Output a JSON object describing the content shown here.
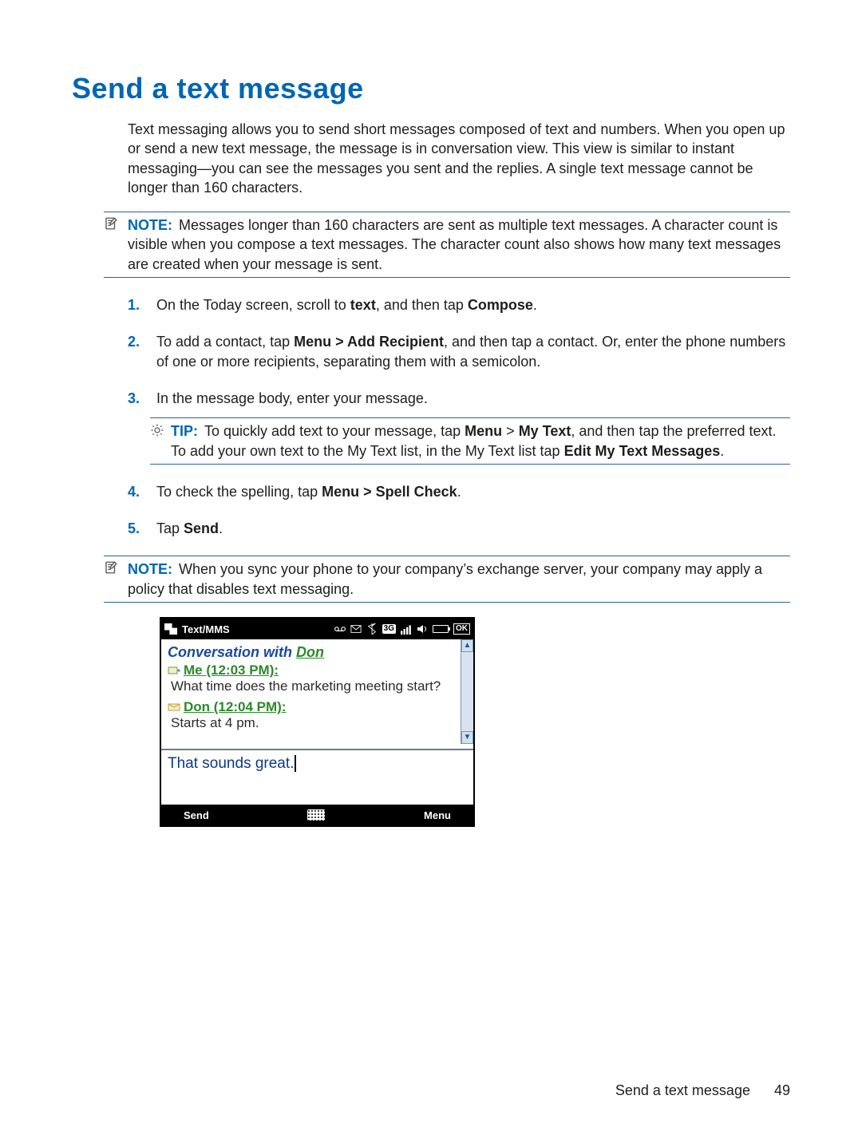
{
  "title": "Send a text message",
  "intro": "Text messaging allows you to send short messages composed of text and numbers. When you open up or send a new text message, the message is in conversation view. This view is similar to instant messaging—you can see the messages you sent and the replies. A single text message cannot be longer than 160 characters.",
  "note1": {
    "label": "NOTE:",
    "text": "Messages longer than 160 characters are sent as multiple text messages. A character count is visible when you compose a text messages. The character count also shows how many text messages are created when your message is sent."
  },
  "steps": {
    "s1_a": "On the Today screen, scroll to ",
    "s1_b": "text",
    "s1_c": ", and then tap ",
    "s1_d": "Compose",
    "s1_e": ".",
    "s2_a": "To add a contact, tap ",
    "s2_b": "Menu > Add Recipient",
    "s2_c": ", and then tap a contact. Or, enter the phone numbers of one or more recipients, separating them with a semicolon.",
    "s3": "In the message body, enter your message.",
    "s4_a": "To check the spelling, tap ",
    "s4_b": "Menu > Spell Check",
    "s4_c": ".",
    "s5_a": "Tap ",
    "s5_b": "Send",
    "s5_c": "."
  },
  "tip": {
    "label": "TIP:",
    "a": "To quickly add text to your message, tap ",
    "b": "Menu",
    "c": " > ",
    "d": "My Text",
    "e": ", and then tap the preferred text. To add your own text to the My Text list, in the My Text list tap ",
    "f": "Edit My Text Messages",
    "g": "."
  },
  "note2": {
    "label": "NOTE:",
    "text": "When you sync your phone to your company’s exchange server, your company may apply a policy that disables text messaging."
  },
  "phone": {
    "title": "Text/MMS",
    "ok": "OK",
    "ind3g": "3G",
    "conversation_prefix": "Conversation with ",
    "contact": "Don",
    "me_label": "Me (12:03 PM):",
    "me_msg": "What time does the marketing meeting start?",
    "don_label": "Don (12:04 PM):",
    "don_msg": "Starts at 4 pm.",
    "compose": "That sounds great.",
    "soft_left": "Send",
    "soft_right": "Menu"
  },
  "footer": {
    "section": "Send a text message",
    "page": "49"
  }
}
